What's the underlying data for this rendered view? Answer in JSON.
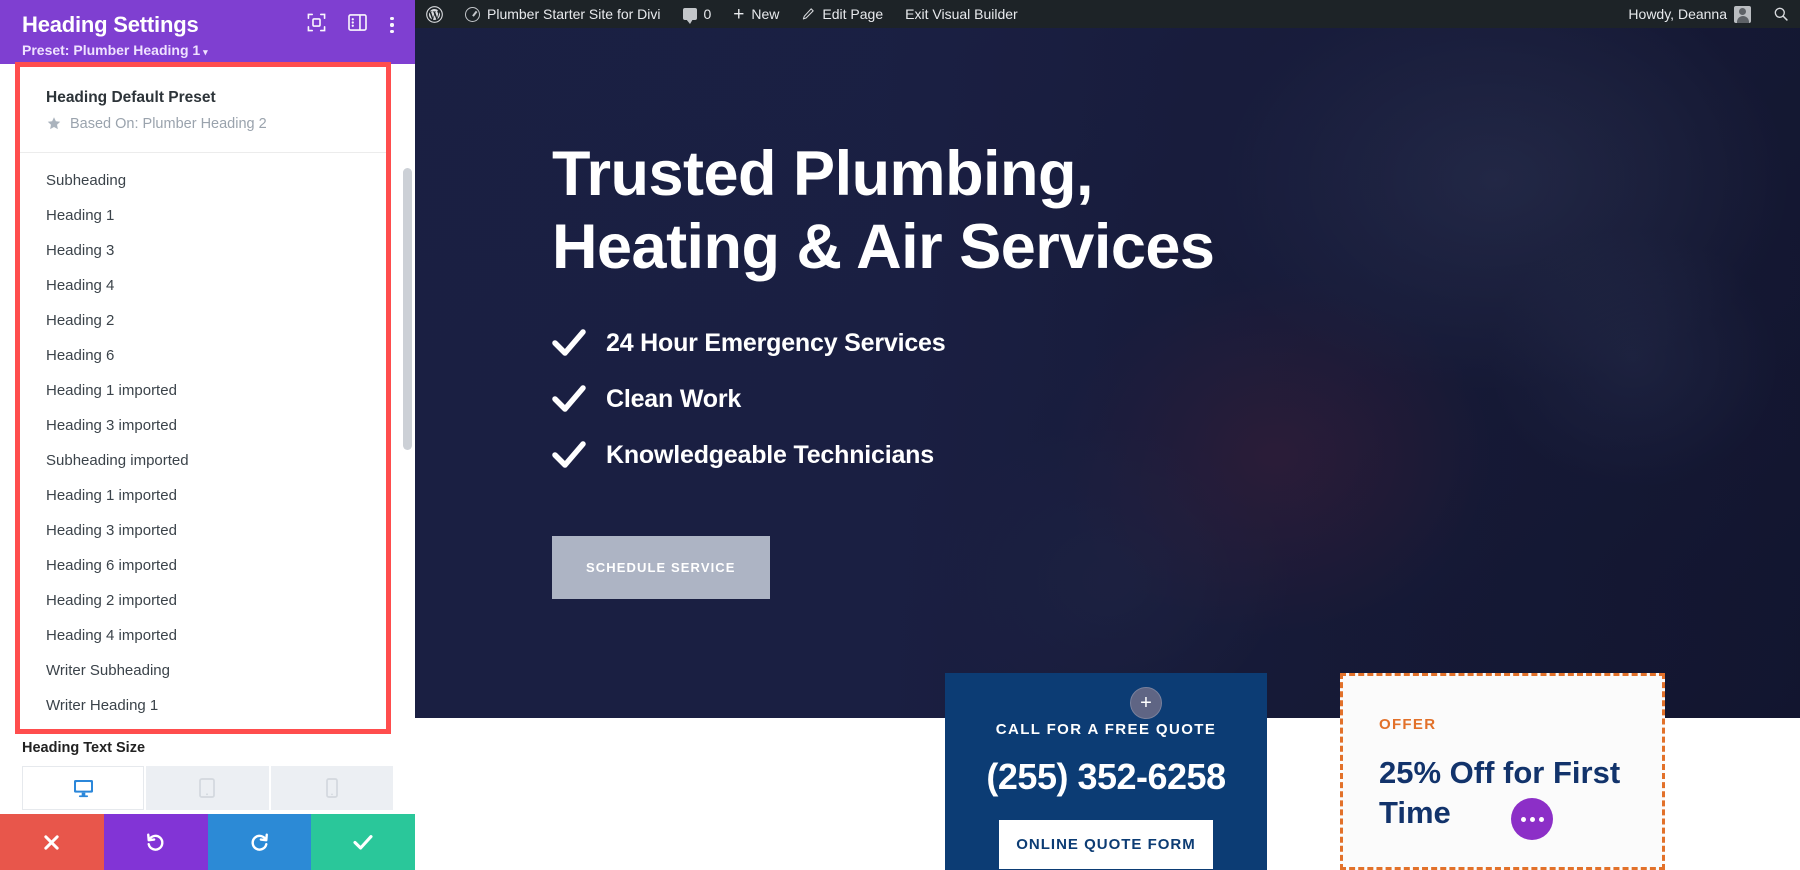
{
  "admin_bar": {
    "wp_logo_label": "wordpress-logo",
    "site_name": "Plumber Starter Site for Divi",
    "comment_count": "0",
    "new_label": "New",
    "edit_page_label": "Edit Page",
    "exit_label": "Exit Visual Builder",
    "howdy": "Howdy, Deanna",
    "bg_color": "#1d2327"
  },
  "panel": {
    "title": "Heading Settings",
    "preset_line": "Preset: Plumber Heading 1",
    "preset_caret": "▾",
    "header_color": "#7f3fd1",
    "highlight_color": "#ff4d4d",
    "dropdown": {
      "current_name": "Heading Default Preset",
      "based_on": "Based On: Plumber Heading 2",
      "items": [
        "Subheading",
        "Heading 1",
        "Heading 3",
        "Heading 4",
        "Heading 2",
        "Heading 6",
        "Heading 1 imported",
        "Heading 3 imported",
        "Subheading imported",
        "Heading 1 imported",
        "Heading 3 imported",
        "Heading 6 imported",
        "Heading 2 imported",
        "Heading 4 imported",
        "Writer Subheading",
        "Writer Heading 1"
      ]
    },
    "text_size_label": "Heading Text Size",
    "devices": [
      {
        "name": "desktop",
        "active": true
      },
      {
        "name": "tablet",
        "active": false
      },
      {
        "name": "phone",
        "active": false
      }
    ],
    "footer": {
      "close": "close-icon",
      "undo": "undo-icon",
      "redo": "redo-icon",
      "save": "save-check-icon"
    }
  },
  "hero": {
    "heading_line1": "Trusted Plumbing,",
    "heading_line2": "Heating & Air Services",
    "bullets": [
      "24 Hour Emergency Services",
      "Clean Work",
      "Knowledgeable Technicians"
    ],
    "cta_label": "SCHEDULE SERVICE",
    "add_section_label": "+"
  },
  "quote_card": {
    "label": "CALL FOR A FREE QUOTE",
    "phone": "(255) 352-6258",
    "button": "ONLINE QUOTE FORM",
    "bg_color": "#0c3c74"
  },
  "offer_card": {
    "tag": "OFFER",
    "heading": "25% Off for First Time",
    "border_color": "#e2712a",
    "heading_color": "#12336b"
  }
}
